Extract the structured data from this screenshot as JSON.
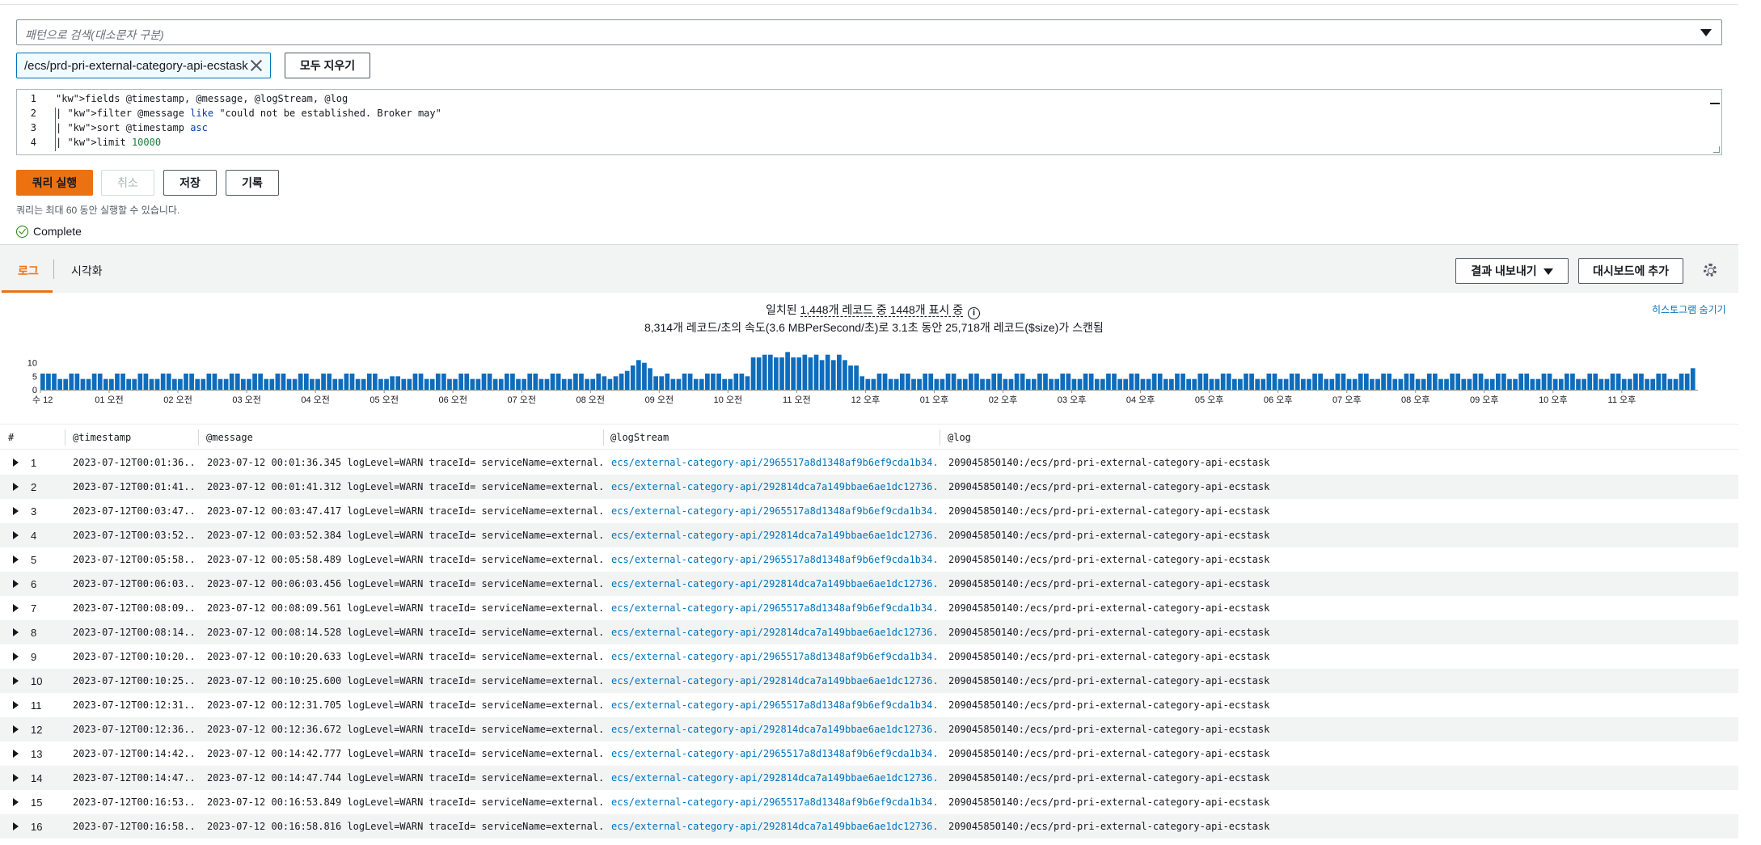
{
  "search": {
    "placeholder": "패턴으로 검색(대소문자 구분)"
  },
  "log_group_token": "/ecs/prd-pri-external-category-api-ecstask",
  "clear_all_label": "모두 지우기",
  "query_lines": [
    {
      "n": "1",
      "text": "fields @timestamp, @message, @logStream, @log"
    },
    {
      "n": "2",
      "text": "| filter @message like \"could not be established. Broker may\""
    },
    {
      "n": "3",
      "text": "| sort @timestamp asc"
    },
    {
      "n": "4",
      "text": "| limit 10000"
    }
  ],
  "buttons": {
    "run": "쿼리 실행",
    "cancel": "취소",
    "save": "저장",
    "history": "기록",
    "export": "결과 내보내기",
    "add_dashboard": "대시보드에 추가"
  },
  "limit_note": "쿼리는 최대 60 동안 실행할 수 있습니다.",
  "status": "Complete",
  "tabs": {
    "logs": "로그",
    "visualization": "시각화"
  },
  "summary": {
    "line1_prefix": "일치된 ",
    "line1_dotted": "1,448개 레코드 중 1448개 표시 중",
    "line2": "8,314개 레코드/초의 속도(3.6 MBPerSecond/초)로 3.1초 동안 25,718개 레코드($size)가 스캔됨"
  },
  "hide_histogram": "히스토그램 숨기기",
  "chart_data": {
    "type": "bar",
    "y_ticks": [
      "10",
      "5",
      "0"
    ],
    "ylim": [
      0,
      15
    ],
    "x_tick_labels": [
      "수 12",
      "01 오전",
      "02 오전",
      "03 오전",
      "04 오전",
      "05 오전",
      "06 오전",
      "07 오전",
      "08 오전",
      "09 오전",
      "10 오전",
      "11 오전",
      "12 오후",
      "01 오후",
      "02 오후",
      "03 오후",
      "04 오후",
      "05 오후",
      "06 오후",
      "07 오후",
      "08 오후",
      "09 오후",
      "10 오후",
      "11 오후"
    ],
    "bin_minutes": 5,
    "values": [
      6,
      6,
      6,
      4,
      4,
      6,
      6,
      4,
      4,
      6,
      6,
      4,
      4,
      6,
      6,
      4,
      4,
      6,
      6,
      4,
      4,
      6,
      6,
      4,
      4,
      6,
      6,
      4,
      4,
      6,
      6,
      4,
      4,
      6,
      6,
      4,
      4,
      6,
      6,
      4,
      4,
      6,
      6,
      4,
      4,
      6,
      6,
      4,
      4,
      6,
      6,
      4,
      4,
      6,
      6,
      4,
      4,
      6,
      6,
      4,
      4,
      5,
      5,
      4,
      4,
      6,
      6,
      4,
      4,
      6,
      6,
      4,
      4,
      6,
      6,
      4,
      4,
      6,
      6,
      4,
      4,
      6,
      6,
      4,
      4,
      6,
      6,
      4,
      4,
      6,
      6,
      4,
      4,
      6,
      6,
      4,
      4,
      6,
      5,
      4,
      5,
      6,
      7,
      9,
      11,
      10,
      8,
      5,
      5,
      6,
      4,
      4,
      6,
      6,
      4,
      4,
      6,
      6,
      6,
      4,
      4,
      6,
      6,
      5,
      12,
      12,
      13,
      13,
      12,
      12,
      14,
      12,
      12,
      13,
      12,
      13,
      11,
      13,
      11,
      13,
      11,
      9,
      9,
      5,
      4,
      4,
      6,
      6,
      4,
      4,
      6,
      6,
      4,
      4,
      6,
      6,
      4,
      4,
      6,
      6,
      4,
      4,
      6,
      6,
      4,
      4,
      6,
      6,
      4,
      4,
      6,
      6,
      4,
      4,
      6,
      6,
      4,
      4,
      6,
      6,
      4,
      4,
      6,
      6,
      4,
      4,
      6,
      6,
      4,
      4,
      6,
      6,
      4,
      4,
      6,
      6,
      4,
      4,
      6,
      6,
      4,
      4,
      6,
      6,
      4,
      4,
      6,
      6,
      4,
      4,
      6,
      6,
      4,
      4,
      6,
      6,
      4,
      4,
      6,
      6,
      4,
      4,
      6,
      6,
      4,
      4,
      6,
      6,
      4,
      4,
      6,
      6,
      4,
      4,
      6,
      6,
      4,
      4,
      6,
      6,
      4,
      4,
      6,
      6,
      4,
      4,
      6,
      6,
      4,
      4,
      6,
      6,
      4,
      4,
      6,
      6,
      4,
      4,
      6,
      6,
      4,
      4,
      6,
      6,
      4,
      4,
      6,
      6,
      4,
      4,
      6,
      6,
      4,
      4,
      6,
      6,
      4,
      4,
      6,
      6,
      4,
      4,
      6,
      6,
      4,
      4,
      6,
      6,
      8
    ]
  },
  "table": {
    "headers": [
      "#",
      "@timestamp",
      "@message",
      "@logStream",
      "@log"
    ],
    "rows": [
      {
        "n": "1",
        "ts": "2023-07-12T00:01:36...",
        "msg": "2023-07-12 00:01:36.345 logLevel=WARN traceId= serviceName=external...",
        "stream": "ecs/external-category-api/2965517a8d1348af9b6ef9cda1b34...",
        "log": "209045850140:/ecs/prd-pri-external-category-api-ecstask"
      },
      {
        "n": "2",
        "ts": "2023-07-12T00:01:41...",
        "msg": "2023-07-12 00:01:41.312 logLevel=WARN traceId= serviceName=external...",
        "stream": "ecs/external-category-api/292814dca7a149bbae6ae1dc12736...",
        "log": "209045850140:/ecs/prd-pri-external-category-api-ecstask"
      },
      {
        "n": "3",
        "ts": "2023-07-12T00:03:47...",
        "msg": "2023-07-12 00:03:47.417 logLevel=WARN traceId= serviceName=external...",
        "stream": "ecs/external-category-api/2965517a8d1348af9b6ef9cda1b34...",
        "log": "209045850140:/ecs/prd-pri-external-category-api-ecstask"
      },
      {
        "n": "4",
        "ts": "2023-07-12T00:03:52...",
        "msg": "2023-07-12 00:03:52.384 logLevel=WARN traceId= serviceName=external...",
        "stream": "ecs/external-category-api/292814dca7a149bbae6ae1dc12736...",
        "log": "209045850140:/ecs/prd-pri-external-category-api-ecstask"
      },
      {
        "n": "5",
        "ts": "2023-07-12T00:05:58...",
        "msg": "2023-07-12 00:05:58.489 logLevel=WARN traceId= serviceName=external...",
        "stream": "ecs/external-category-api/2965517a8d1348af9b6ef9cda1b34...",
        "log": "209045850140:/ecs/prd-pri-external-category-api-ecstask"
      },
      {
        "n": "6",
        "ts": "2023-07-12T00:06:03...",
        "msg": "2023-07-12 00:06:03.456 logLevel=WARN traceId= serviceName=external...",
        "stream": "ecs/external-category-api/292814dca7a149bbae6ae1dc12736...",
        "log": "209045850140:/ecs/prd-pri-external-category-api-ecstask"
      },
      {
        "n": "7",
        "ts": "2023-07-12T00:08:09...",
        "msg": "2023-07-12 00:08:09.561 logLevel=WARN traceId= serviceName=external...",
        "stream": "ecs/external-category-api/2965517a8d1348af9b6ef9cda1b34...",
        "log": "209045850140:/ecs/prd-pri-external-category-api-ecstask"
      },
      {
        "n": "8",
        "ts": "2023-07-12T00:08:14...",
        "msg": "2023-07-12 00:08:14.528 logLevel=WARN traceId= serviceName=external...",
        "stream": "ecs/external-category-api/292814dca7a149bbae6ae1dc12736...",
        "log": "209045850140:/ecs/prd-pri-external-category-api-ecstask"
      },
      {
        "n": "9",
        "ts": "2023-07-12T00:10:20...",
        "msg": "2023-07-12 00:10:20.633 logLevel=WARN traceId= serviceName=external...",
        "stream": "ecs/external-category-api/2965517a8d1348af9b6ef9cda1b34...",
        "log": "209045850140:/ecs/prd-pri-external-category-api-ecstask"
      },
      {
        "n": "10",
        "ts": "2023-07-12T00:10:25...",
        "msg": "2023-07-12 00:10:25.600 logLevel=WARN traceId= serviceName=external...",
        "stream": "ecs/external-category-api/292814dca7a149bbae6ae1dc12736...",
        "log": "209045850140:/ecs/prd-pri-external-category-api-ecstask"
      },
      {
        "n": "11",
        "ts": "2023-07-12T00:12:31...",
        "msg": "2023-07-12 00:12:31.705 logLevel=WARN traceId= serviceName=external...",
        "stream": "ecs/external-category-api/2965517a8d1348af9b6ef9cda1b34...",
        "log": "209045850140:/ecs/prd-pri-external-category-api-ecstask"
      },
      {
        "n": "12",
        "ts": "2023-07-12T00:12:36...",
        "msg": "2023-07-12 00:12:36.672 logLevel=WARN traceId= serviceName=external...",
        "stream": "ecs/external-category-api/292814dca7a149bbae6ae1dc12736...",
        "log": "209045850140:/ecs/prd-pri-external-category-api-ecstask"
      },
      {
        "n": "13",
        "ts": "2023-07-12T00:14:42...",
        "msg": "2023-07-12 00:14:42.777 logLevel=WARN traceId= serviceName=external...",
        "stream": "ecs/external-category-api/2965517a8d1348af9b6ef9cda1b34...",
        "log": "209045850140:/ecs/prd-pri-external-category-api-ecstask"
      },
      {
        "n": "14",
        "ts": "2023-07-12T00:14:47...",
        "msg": "2023-07-12 00:14:47.744 logLevel=WARN traceId= serviceName=external...",
        "stream": "ecs/external-category-api/292814dca7a149bbae6ae1dc12736...",
        "log": "209045850140:/ecs/prd-pri-external-category-api-ecstask"
      },
      {
        "n": "15",
        "ts": "2023-07-12T00:16:53...",
        "msg": "2023-07-12 00:16:53.849 logLevel=WARN traceId= serviceName=external...",
        "stream": "ecs/external-category-api/2965517a8d1348af9b6ef9cda1b34...",
        "log": "209045850140:/ecs/prd-pri-external-category-api-ecstask"
      },
      {
        "n": "16",
        "ts": "2023-07-12T00:16:58...",
        "msg": "2023-07-12 00:16:58.816 logLevel=WARN traceId= serviceName=external...",
        "stream": "ecs/external-category-api/292814dca7a149bbae6ae1dc12736...",
        "log": "209045850140:/ecs/prd-pri-external-category-api-ecstask"
      }
    ]
  },
  "colors": {
    "accent": "#ec7211",
    "link": "#0073bb",
    "bar": "#0f6cbd",
    "success": "#1d8102"
  }
}
